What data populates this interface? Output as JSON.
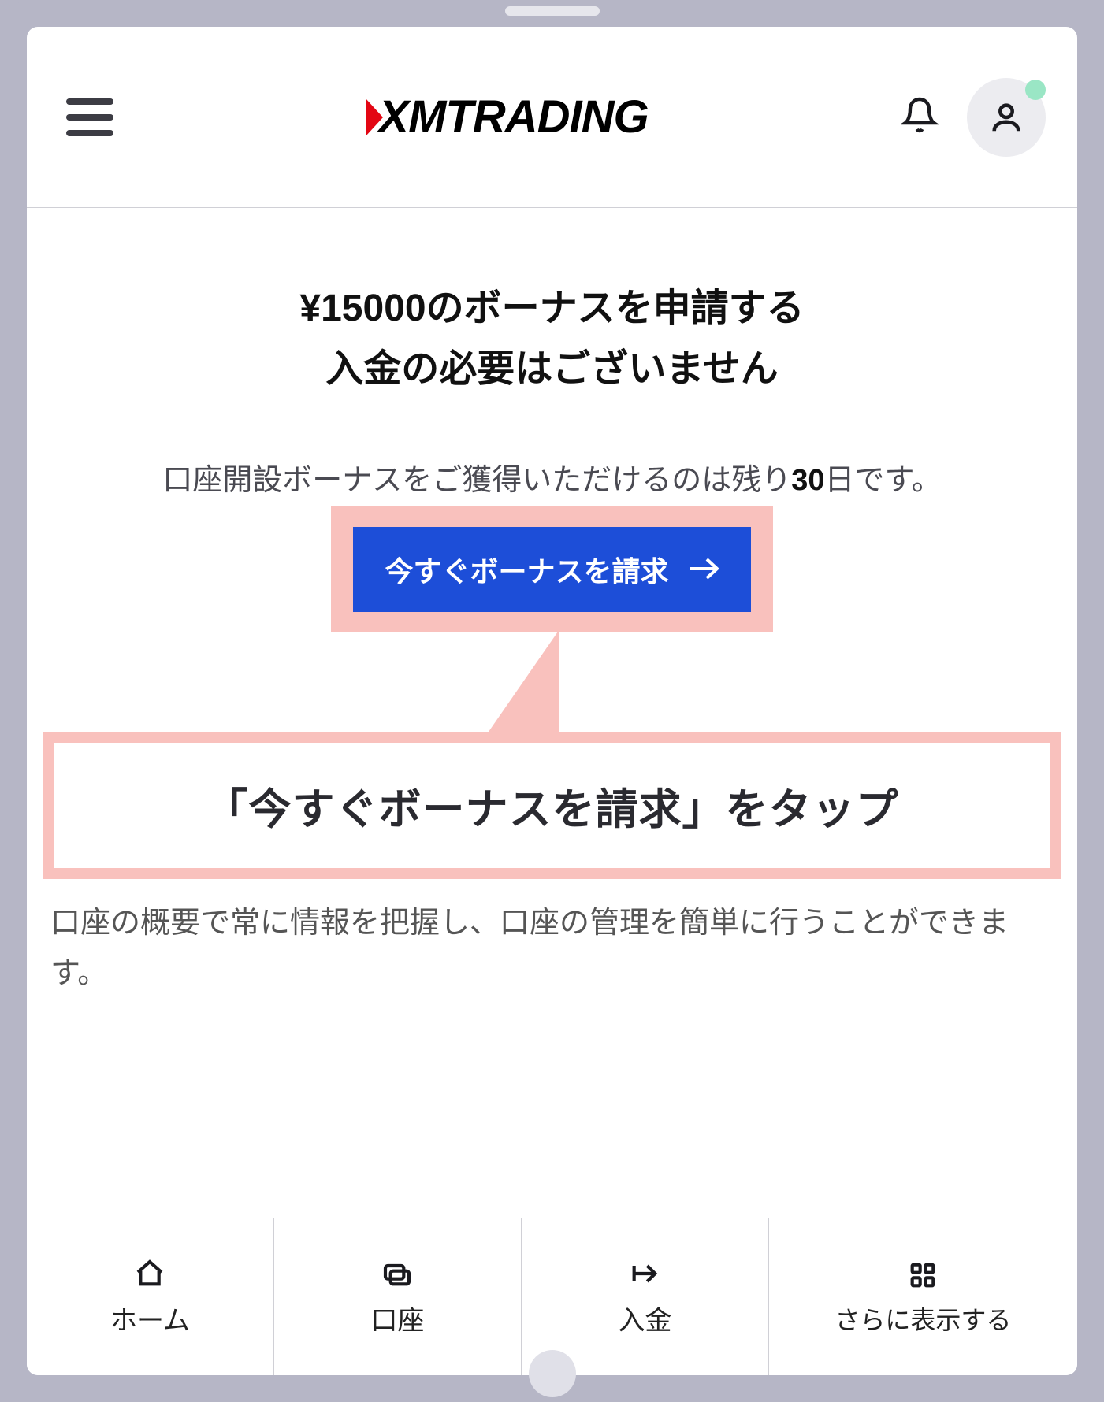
{
  "brand": "XMTRADING",
  "hero": {
    "title_line1": "¥15000のボーナスを申請する",
    "title_line2": "入金の必要はございません",
    "subtext_prefix": "口座開設ボーナスをご獲得いただけるのは残り",
    "days": "30",
    "subtext_suffix": "日です。",
    "cta_label": "今すぐボーナスを請求"
  },
  "callout": {
    "text": "「今すぐボーナスを請求」をタップ"
  },
  "description": "口座の概要で常に情報を把握し、口座の管理を簡単に行うことができます。",
  "tabs": {
    "home": "ホーム",
    "account": "口座",
    "deposit": "入金",
    "more": "さらに表示する"
  }
}
